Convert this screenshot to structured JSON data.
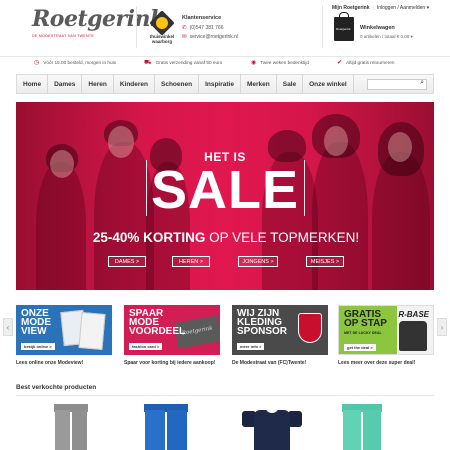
{
  "header": {
    "logo_text": "Roetgerink",
    "logo_tagline": "DE MODESTRAAT VAN TWENTE",
    "thuiswinkel_label": "thuiswinkel waarborg",
    "service": {
      "title": "Klantenservice",
      "phone": "(0)547 381 766",
      "email": "service@roetgerink.nl"
    },
    "account": {
      "mine": "Mijn Roetgerink",
      "login": "Inloggen / Aanmelden"
    },
    "cart": {
      "title": "Winkelwagen",
      "summary": "0 artikelen / totaal € 0,00",
      "bag_text": "Roetgerink"
    }
  },
  "usps": [
    {
      "text": "Vóór 15.00 besteld, morgen in huis",
      "icon": "clock-icon"
    },
    {
      "text": "Gratis verzending vanaf 50 euro",
      "icon": "truck-icon"
    },
    {
      "text": "Twee weken bedenktijd",
      "icon": "eye-icon"
    },
    {
      "text": "Altijd gratis retourneren",
      "icon": "check-icon"
    }
  ],
  "nav": {
    "items": [
      "Home",
      "Dames",
      "Heren",
      "Kinderen",
      "Schoenen",
      "Inspiratie",
      "Merken",
      "Sale",
      "Onze winkel"
    ],
    "search_placeholder": ""
  },
  "hero": {
    "kicker": "HET IS",
    "headline": "SALE",
    "discount_bold": "25-40% KORTING",
    "discount_rest": "OP VELE TOPMERKEN!",
    "buttons": [
      "DAMES >",
      "HEREN >",
      "JONGENS >",
      "MEISJES >"
    ]
  },
  "promos": [
    {
      "title": "ONZE\nMODE\nVIEW",
      "badge": "bekijk online >",
      "caption": "Lees online onze Modeview!"
    },
    {
      "title": "SPAAR\nMODE\nVOORDEEL",
      "badge": "fashion card >",
      "card_text": "Roetgerink",
      "caption": "Spaar voor korting bij iedere aankoop!"
    },
    {
      "title": "WIJ ZIJN\nKLEDING\nSPONSOR",
      "badge": "meer info >",
      "caption": "De Modestraat van (FC)Twente!"
    },
    {
      "title": "GRATIS\nOP STAP",
      "subtitle": "MET DE LUCKY DEAL",
      "badge": "get the deal >",
      "brand": "R-BASE",
      "caption": "Lees meer over deze super deal!"
    }
  ],
  "best_sellers": {
    "title": "Best verkochte producten"
  },
  "colors": {
    "brand_red": "#c8102e",
    "hero_red": "#d5164a",
    "promo_blue": "#2a73b8",
    "promo_pink": "#d21e55",
    "promo_grey": "#4a4a4a",
    "promo_green": "#8cc63f"
  }
}
